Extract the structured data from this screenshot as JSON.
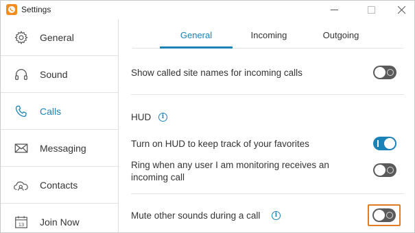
{
  "window": {
    "title": "Settings",
    "min_icon": "minimize-icon",
    "max_icon": "maximize-icon",
    "close_icon": "close-icon"
  },
  "sidebar": {
    "items": [
      {
        "label": "General",
        "icon": "gear-icon"
      },
      {
        "label": "Sound",
        "icon": "headphones-icon"
      },
      {
        "label": "Calls",
        "icon": "phone-icon",
        "active": true
      },
      {
        "label": "Messaging",
        "icon": "envelope-icon"
      },
      {
        "label": "Contacts",
        "icon": "contacts-cloud-icon"
      },
      {
        "label": "Join Now",
        "icon": "calendar-icon",
        "calendar_day": "13"
      }
    ]
  },
  "tabs": [
    {
      "label": "General",
      "active": true
    },
    {
      "label": "Incoming"
    },
    {
      "label": "Outgoing"
    }
  ],
  "settings": {
    "show_called_site": {
      "label": "Show called site names for incoming calls",
      "enabled": false
    },
    "hud_heading": "HUD",
    "hud_turn_on": {
      "label": "Turn on HUD to keep track of your favorites",
      "enabled": true
    },
    "ring_monitoring": {
      "label_line1": "Ring when any user I am monitoring receives an",
      "label_line2": "incoming call",
      "enabled": false
    },
    "mute_other_sounds": {
      "label": "Mute other sounds during a call",
      "enabled": false,
      "focused": true
    }
  },
  "colors": {
    "accent": "#1a82b6",
    "toggle_off": "#5a5a5a",
    "focus": "#e07b1f",
    "logo": "#f28c1e"
  }
}
